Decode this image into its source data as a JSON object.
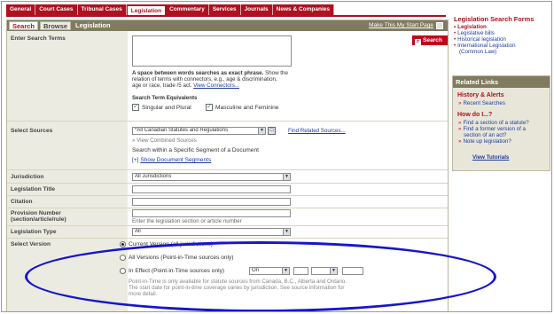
{
  "nav": {
    "tabs": [
      {
        "label": "General",
        "active": false
      },
      {
        "label": "Court Cases",
        "active": false
      },
      {
        "label": "Tribunal Cases",
        "active": false
      },
      {
        "label": "Legislation",
        "active": true
      },
      {
        "label": "Commentary",
        "active": false
      },
      {
        "label": "Services",
        "active": false
      },
      {
        "label": "Journals",
        "active": false
      },
      {
        "label": "News & Companies",
        "active": false
      }
    ]
  },
  "subnav": {
    "search": "Search",
    "browse": "Browse",
    "section": "Legislation",
    "make_tab": "Make This My Start Page"
  },
  "form": {
    "search_terms": {
      "label": "Enter Search Terms",
      "button": "Search",
      "hint_bold": "A space between words searches as exact phrase.",
      "hint_rest": "Show the",
      "hint_line2": "relation of terms with connectors, e.g., age & discrimination,",
      "hint_line3": "age or race, trade /5 act.",
      "hint_link": "View Connectors..."
    },
    "equivalents": {
      "heading": "Search Term Equivalents",
      "singular": "Singular and Plural",
      "masculine": "Masculine and Feminine"
    },
    "sources": {
      "label": "Select Sources",
      "value": "*All Canadian Statutes and Regulations",
      "related_link": "Find Related Sources...",
      "view_combined": "View Combined Sources",
      "within_segment": "Search within a Specific Segment of a Document",
      "show_segments_prefix": "[+]",
      "show_segments": "Show Document Segments"
    },
    "jurisdiction": {
      "label": "Jurisdiction",
      "value": "All Jurisdictions"
    },
    "legislation_title": {
      "label": "Legislation Title"
    },
    "citation": {
      "label": "Citation"
    },
    "provision": {
      "label_line1": "Provision Number",
      "label_line2": "(section/article/rule)",
      "hint": "Enter the legislation section or article number"
    },
    "legislation_type": {
      "label": "Legislation Type",
      "value": "All"
    },
    "version": {
      "label": "Select Version",
      "options": [
        {
          "label": "Current Version (all jurisdictions)",
          "selected": true
        },
        {
          "label": "All Versions (Point-in-Time sources only)",
          "selected": false
        },
        {
          "label": "In Effect (Point-in-Time sources only)",
          "selected": false
        }
      ],
      "in_effect_value": "On",
      "note_line1": "Point-in-Time is only available for statute sources from Canada, B.C., Alberta and Ontario.",
      "note_line2": "The start date for point-in-time coverage varies by jurisdiction. See source information for",
      "note_line3": "more detail."
    }
  },
  "sidebar": {
    "title": "Legislation Search Forms",
    "forms": [
      "Legislation",
      "Legislative bills",
      "Historical legislation",
      "International Legislation",
      "(Common Law)"
    ],
    "related": {
      "title": "Related Links",
      "history_heading": "History & Alerts",
      "recent": "Recent Searches",
      "howdoi_heading": "How do I...?",
      "howdoi_items": [
        "Find a section of a statute?",
        "Find a former version of a",
        "section of an act?",
        "Note up legislation?"
      ],
      "tutorials": "View Tutorials"
    }
  },
  "colors": {
    "brand_red": "#b0101f",
    "olive": "#807a5f",
    "label_bg": "#ecebe1",
    "link_blue": "#1f3d9c",
    "highlight_ellipse": "#1616cc"
  }
}
